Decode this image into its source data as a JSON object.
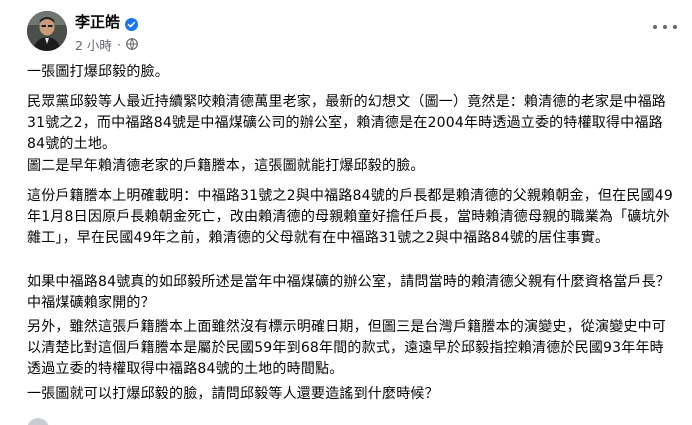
{
  "post": {
    "author": "李正皓",
    "time": "2 小時",
    "separator": "·",
    "verified_icon": "verified-badge-icon",
    "audience_icon": "globe-icon",
    "paragraphs": [
      "一張圖打爆邱毅的臉。",
      "民眾黨邱毅等人最近持續緊咬賴清德萬里老家，最新的幻想文（圖一）竟然是：賴清德的老家是中福路31號之2，而中福路84號是中福煤礦公司的辦公室，賴清德是在2004年時透過立委的特權取得中福路84號的土地。",
      "圖二是早年賴清德老家的戶籍謄本，這張圖就能打爆邱毅的臉。",
      "這份戶籍謄本上明確載明：中福路31號之2與中福路84號的戶長都是賴清德的父親賴朝金，但在民國49年1月8日因原戶長賴朝金死亡，改由賴清德的母親賴童好擔任戶長，當時賴清德母親的職業為「礦坑外雜工」，早在民國49年之前，賴清德的父母就有在中福路31號之2與中福路84號的居住事實。",
      "如果中福路84號真的如邱毅所述是當年中福煤礦的辦公室，請問當時的賴清德父親有什麼資格當戶長？中福煤礦賴家開的？",
      "另外，雖然這張戶籍謄本上面雖然沒有標示明確日期，但圖三是台灣戶籍謄本的演變史，從演變史中可以清楚比對這個戶籍謄本是屬於民國59年到68年間的款式，遠遠早於邱毅指控賴清德於民國93年年時透過立委的特權取得中福路84號的土地的時間點。",
      "一張圖就可以打爆邱毅的臉，請問邱毅等人還要造謠到什麼時候？"
    ]
  },
  "colors": {
    "verified": "#1877f2",
    "meta": "#65676b",
    "text": "#050505"
  }
}
